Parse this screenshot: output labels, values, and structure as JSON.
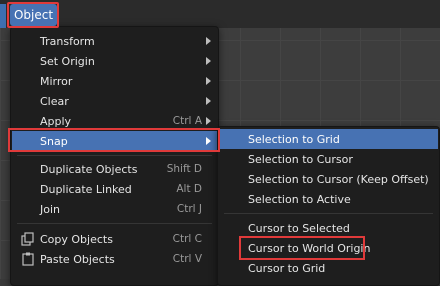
{
  "header": {
    "menu_label": "Object"
  },
  "main_menu": {
    "items": [
      {
        "label": "Transform",
        "shortcut": "",
        "submenu": true
      },
      {
        "label": "Set Origin",
        "shortcut": "",
        "submenu": true
      },
      {
        "label": "Mirror",
        "shortcut": "",
        "submenu": true
      },
      {
        "label": "Clear",
        "shortcut": "",
        "submenu": true
      },
      {
        "label": "Apply",
        "shortcut": "Ctrl A",
        "submenu": true
      },
      {
        "label": "Snap",
        "shortcut": "",
        "submenu": true
      },
      {
        "label": "Duplicate Objects",
        "shortcut": "Shift D"
      },
      {
        "label": "Duplicate Linked",
        "shortcut": "Alt D"
      },
      {
        "label": "Join",
        "shortcut": "Ctrl J"
      },
      {
        "label": "Copy Objects",
        "shortcut": "Ctrl C"
      },
      {
        "label": "Paste Objects",
        "shortcut": "Ctrl V"
      }
    ]
  },
  "snap_menu": {
    "items": [
      {
        "label": "Selection to Grid"
      },
      {
        "label": "Selection to Cursor"
      },
      {
        "label": "Selection to Cursor (Keep Offset)"
      },
      {
        "label": "Selection to Active"
      },
      {
        "label": "Cursor to Selected"
      },
      {
        "label": "Cursor to World Origin"
      },
      {
        "label": "Cursor to Grid"
      }
    ]
  },
  "peek_text": "S",
  "colors": {
    "accent": "#4772b3",
    "highlight_box": "#e03a3a",
    "menu_bg": "#1e1e1e"
  }
}
